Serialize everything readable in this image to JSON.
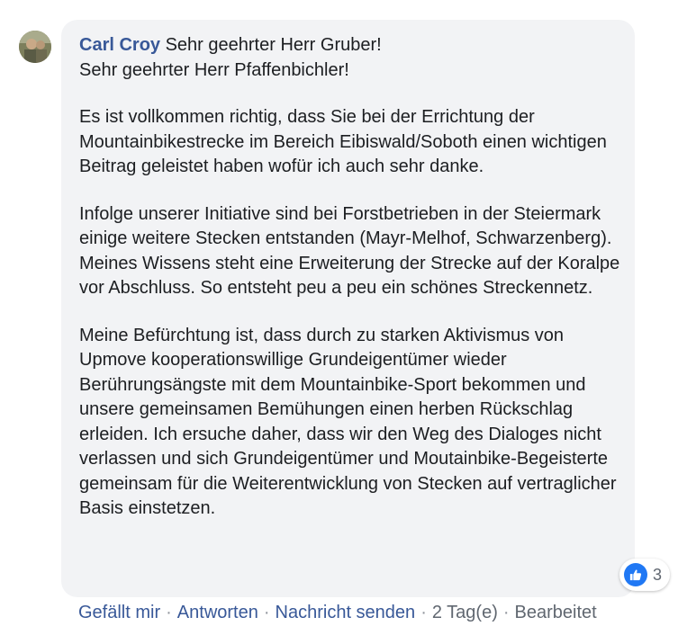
{
  "comment": {
    "author": "Carl Croy",
    "lines": [
      "Sehr geehrter Herr Gruber!",
      "Sehr geehrter Herr Pfaffenbichler!"
    ],
    "paragraphs": [
      "Es ist vollkommen richtig, dass Sie bei der Errichtung der Mountainbikestrecke im Bereich Eibiswald/Soboth einen wichtigen Beitrag geleistet haben wofür ich auch sehr danke.",
      "Infolge unserer Initiative sind bei Forstbetrieben in der Steiermark einige weitere Stecken entstanden (Mayr-Melhof, Schwarzenberg). Meines Wissens steht eine Erweiterung der Strecke auf der Koralpe vor Abschluss. So entsteht peu a peu ein schönes Streckennetz.",
      "Meine Befürchtung ist, dass durch zu starken Aktivismus von Upmove kooperationswillige Grundeigentümer wieder Berührungsängste mit dem Mountainbike-Sport bekommen und unsere gemeinsamen Bemühungen einen herben Rückschlag erleiden. Ich ersuche daher, dass wir den Weg des Dialoges nicht verlassen und sich Grundeigentümer und Moutainbike-Begeisterte gemeinsam für die Weiterentwicklung von Stecken auf vertraglicher Basis einstetzen."
    ]
  },
  "reactions": {
    "icon": "like-icon",
    "count": "3"
  },
  "actions": {
    "like": "Gefällt mir",
    "reply": "Antworten",
    "message": "Nachricht senden",
    "separator": "·",
    "time": "2 Tag(e)",
    "edited": "Bearbeitet"
  },
  "colors": {
    "link": "#385898",
    "bubble": "#f2f3f5",
    "like": "#2078f4",
    "meta": "#606770"
  }
}
